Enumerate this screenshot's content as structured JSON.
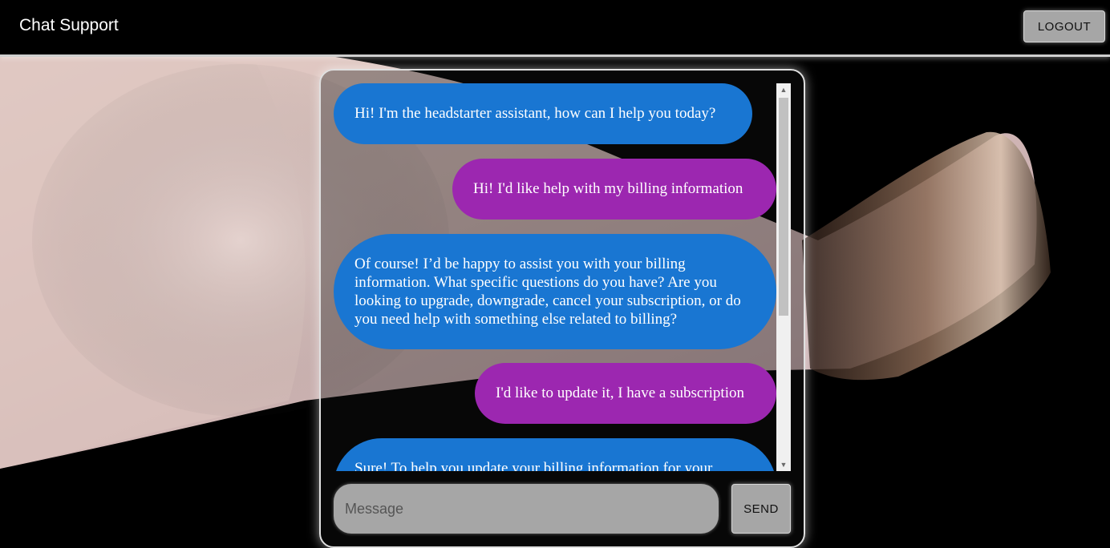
{
  "header": {
    "title": "Chat Support",
    "logout_label": "LOGOUT"
  },
  "chat": {
    "messages": [
      {
        "role": "bot",
        "text": "Hi! I'm the headstarter assistant, how can I help you today?"
      },
      {
        "role": "user",
        "text": "Hi! I'd like help with my billing information"
      },
      {
        "role": "bot",
        "text": "Of course! I’d be happy to assist you with your billing information. What specific questions do you have? Are you looking to upgrade, downgrade, cancel your subscription, or do you need help with something else related to billing?"
      },
      {
        "role": "user",
        "text": "I'd like to update it, I have a subscription"
      },
      {
        "role": "bot",
        "text": "Sure! To help you update your billing information for your"
      }
    ]
  },
  "composer": {
    "placeholder": "Message",
    "send_label": "SEND"
  },
  "colors": {
    "bot_bubble": "#1976d2",
    "user_bubble": "#9c27b0",
    "button_gray": "#a6a6a6"
  }
}
